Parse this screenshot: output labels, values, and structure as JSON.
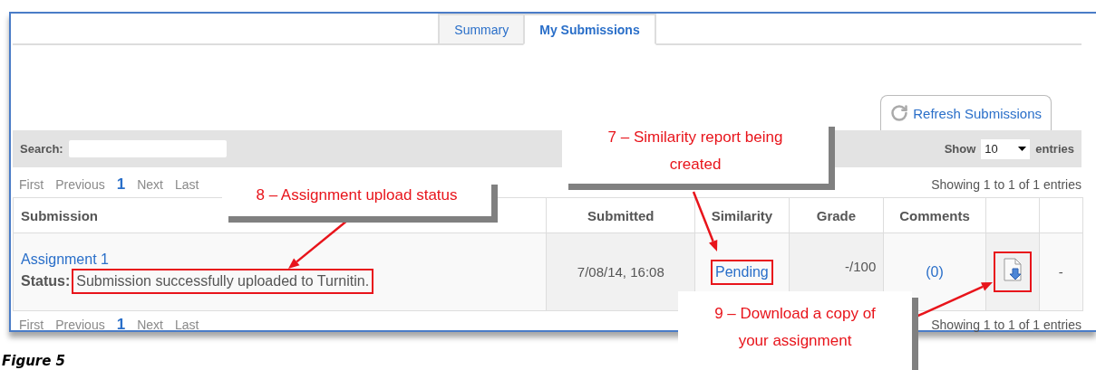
{
  "tabs": [
    {
      "label": "Summary",
      "selected": false
    },
    {
      "label": "My Submissions",
      "selected": true
    }
  ],
  "refresh_button": {
    "label": "Refresh Submissions"
  },
  "search": {
    "label": "Search:"
  },
  "page_length": {
    "label": "Show",
    "value": "10",
    "suffix": "entries"
  },
  "pager_top": {
    "items": [
      {
        "label": "First",
        "selected": false
      },
      {
        "label": "Previous",
        "selected": false
      },
      {
        "label": "1",
        "selected": true
      },
      {
        "label": "Next",
        "selected": false
      },
      {
        "label": "Last",
        "selected": false
      }
    ],
    "info": "Showing 1 to 1 of 1 entries"
  },
  "table": {
    "columns": [
      "Submission",
      "Submitted",
      "Similarity",
      "Grade",
      "Comments"
    ],
    "rows": [
      {
        "title": "Assignment 1",
        "status_label": "Status:",
        "status": "Submission successfully uploaded to Turnitin.",
        "status_highlighted": true,
        "submitted": "7/08/14, 16:08",
        "similarity": "Pending",
        "similarity_highlighted": true,
        "grade": "-/100",
        "comments": "(0)",
        "download_highlighted": true,
        "column_7": "-"
      }
    ]
  },
  "pager_bottom": {
    "items": [
      {
        "label": "First",
        "selected": false
      },
      {
        "label": "Previous",
        "selected": false
      },
      {
        "label": "1",
        "selected": true
      },
      {
        "label": "Next",
        "selected": false
      },
      {
        "label": "Last",
        "selected": false
      }
    ],
    "info": "Showing 1 to 1 of 1 entries"
  },
  "callouts": [
    {
      "text": "7 – Similarity report being created"
    },
    {
      "text": "8 – Assignment upload status"
    },
    {
      "text": "9 – Download a copy of your assignment"
    }
  ],
  "caption": "Figure 5"
}
